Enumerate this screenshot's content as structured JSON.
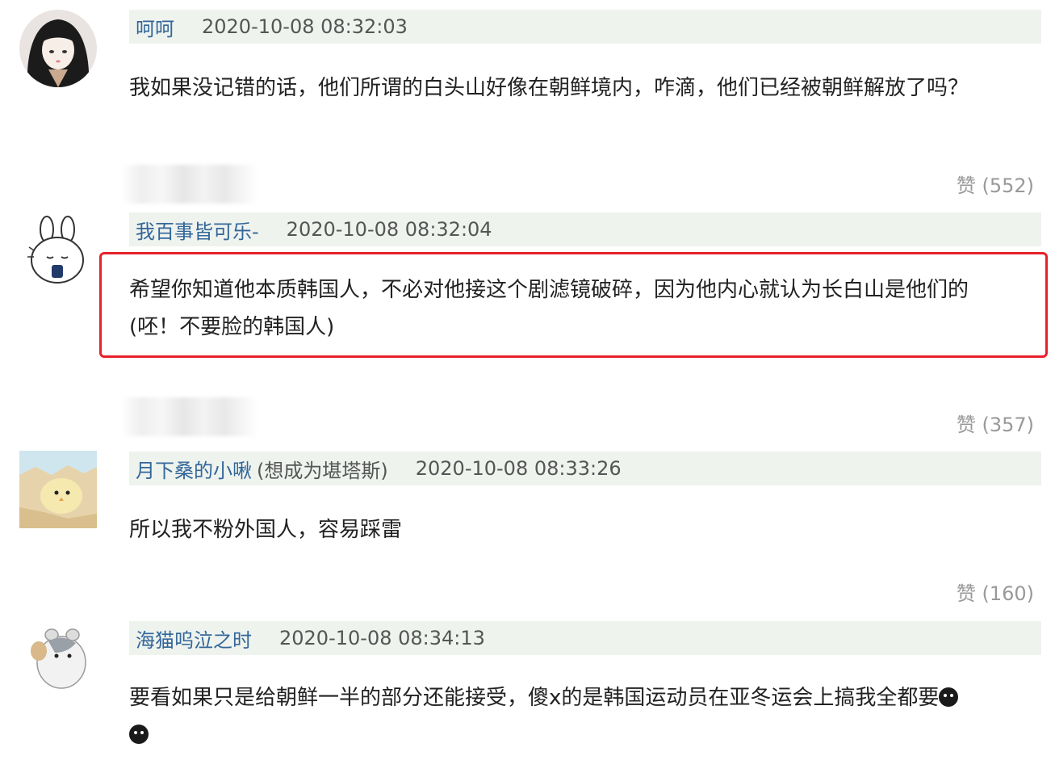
{
  "comments": [
    {
      "username": "呵呵",
      "tag": "",
      "timestamp": "2020-10-08 08:32:03",
      "text": "我如果没记错的话，他们所谓的白头山好像在朝鲜境内，咋滴，他们已经被朝鲜解放了吗？",
      "likes": "赞 (552)"
    },
    {
      "username": "我百事皆可乐-",
      "tag": "",
      "timestamp": "2020-10-08 08:32:04",
      "text_line1": "希望你知道他本质韩国人，不必对他接这个剧滤镜破碎，因为他内心就认为长白山是他们的",
      "text_line2": "(呸！不要脸的韩国人)",
      "likes": "赞 (357)"
    },
    {
      "username": "月下桑的小啾",
      "tag": "(想成为堪塔斯)",
      "timestamp": "2020-10-08 08:33:26",
      "text": "所以我不粉外国人，容易踩雷",
      "likes": "赞 (160)"
    },
    {
      "username": "海猫呜泣之时",
      "tag": "",
      "timestamp": "2020-10-08 08:34:13",
      "text": "要看如果只是给朝鲜一半的部分还能接受，傻x的是韩国运动员在亚冬运会上搞我全都要"
    }
  ],
  "colors": {
    "username": "#336699",
    "header_bg": "#eef3ee",
    "highlight": "#e8202a",
    "likes": "#999999"
  },
  "icons": [
    "avatar-girl",
    "avatar-bunny",
    "avatar-chick",
    "avatar-hamster",
    "dark-face-emoji"
  ]
}
